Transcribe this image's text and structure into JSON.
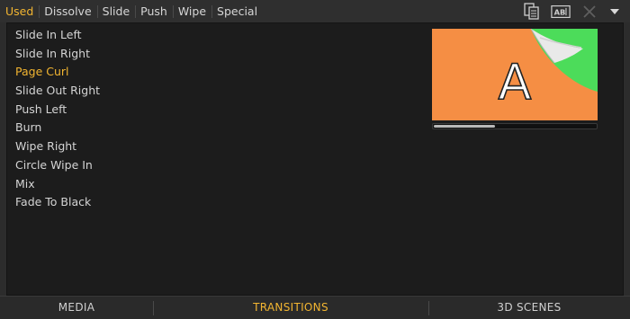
{
  "tabs": [
    {
      "label": "Used",
      "active": true
    },
    {
      "label": "Dissolve",
      "active": false
    },
    {
      "label": "Slide",
      "active": false
    },
    {
      "label": "Push",
      "active": false
    },
    {
      "label": "Wipe",
      "active": false
    },
    {
      "label": "Special",
      "active": false
    }
  ],
  "toolbar": {
    "icons": [
      "copy-icon",
      "text-ab-icon",
      "close-icon"
    ]
  },
  "transitions": [
    {
      "label": "Slide In Left",
      "selected": false
    },
    {
      "label": "Slide In Right",
      "selected": false
    },
    {
      "label": "Page Curl",
      "selected": true
    },
    {
      "label": "Slide Out Right",
      "selected": false
    },
    {
      "label": "Push Left",
      "selected": false
    },
    {
      "label": "Burn",
      "selected": false
    },
    {
      "label": "Wipe Right",
      "selected": false
    },
    {
      "label": "Circle Wipe In",
      "selected": false
    },
    {
      "label": "Mix",
      "selected": false
    },
    {
      "label": "Fade To Black",
      "selected": false
    }
  ],
  "preview": {
    "letter": "A",
    "colors": {
      "background": "#f58e44",
      "revealed": "#4cdc5a",
      "curl": "#e9e9e9"
    },
    "progress": 0.38
  },
  "bottom_tabs": [
    {
      "label": "MEDIA",
      "active": false
    },
    {
      "label": "TRANSITIONS",
      "active": true
    },
    {
      "label": "3D SCENES",
      "active": false
    }
  ],
  "colors": {
    "accent": "#f2b531"
  }
}
